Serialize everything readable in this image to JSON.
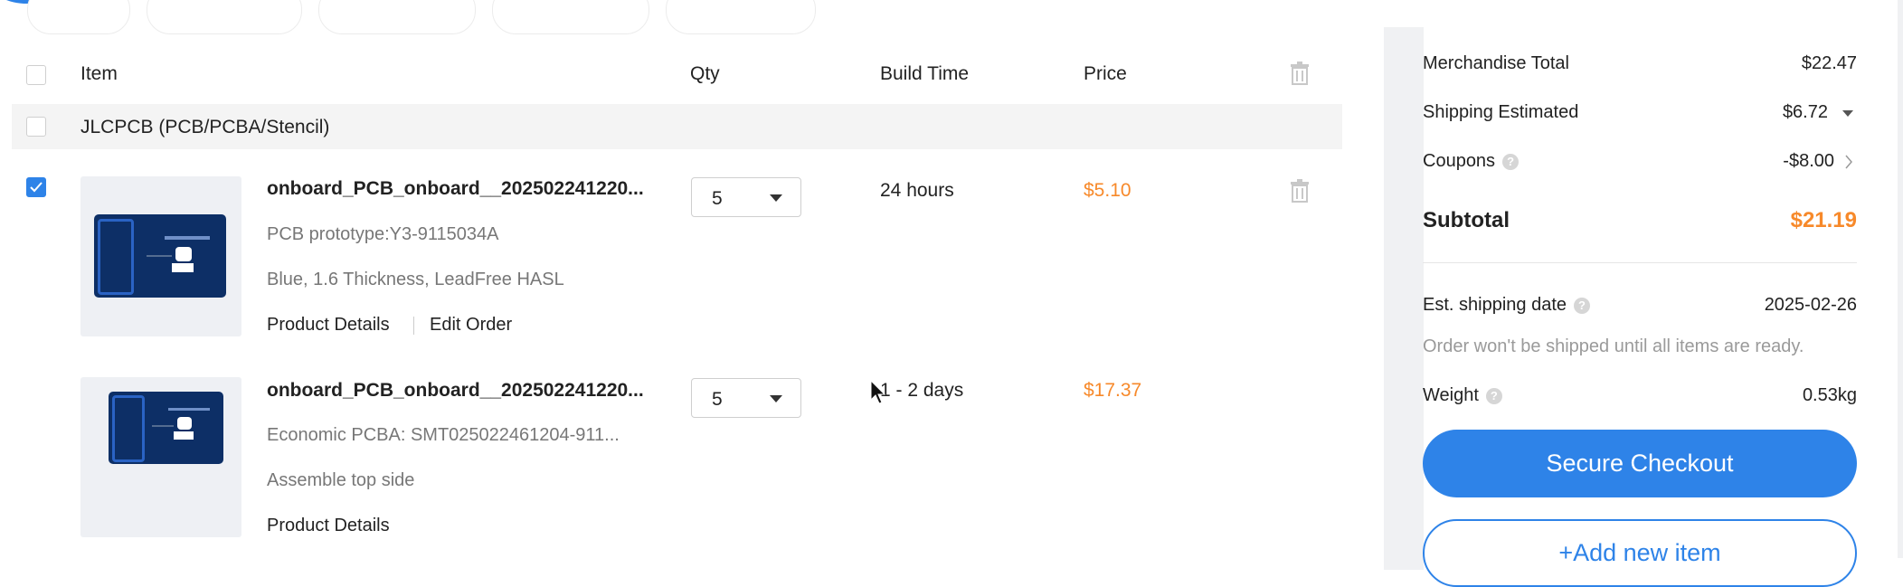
{
  "header": {
    "col_item": "Item",
    "col_qty": "Qty",
    "col_build_time": "Build Time",
    "col_price": "Price"
  },
  "group": {
    "label": "JLCPCB (PCB/PCBA/Stencil)"
  },
  "items": [
    {
      "title": "onboard_PCB_onboard__202502241220...",
      "line1": "PCB prototype:Y3-9115034A",
      "line2": "Blue, 1.6 Thickness, LeadFree HASL",
      "link1": "Product Details",
      "link2": "Edit Order",
      "qty": "5",
      "build_time": "24 hours",
      "price": "$5.10",
      "checked": true
    },
    {
      "title": "onboard_PCB_onboard__202502241220...",
      "line1": "Economic PCBA: SMT025022461204-911...",
      "line2": "Assemble top side",
      "link1": "Product Details",
      "qty": "5",
      "build_time": "1 - 2 days",
      "price": "$17.37",
      "checked": false
    }
  ],
  "summary": {
    "merch_label": "Merchandise Total",
    "merch_value": "$22.47",
    "ship_label": "Shipping Estimated",
    "ship_value": "$6.72",
    "coupons_label": "Coupons",
    "coupons_value": "-$8.00",
    "subtotal_label": "Subtotal",
    "subtotal_value": "$21.19",
    "est_ship_label": "Est. shipping date",
    "est_ship_value": "2025-02-26",
    "ship_note": "Order won't be shipped until all items are ready.",
    "weight_label": "Weight",
    "weight_value": "0.53kg",
    "checkout_label": "Secure Checkout",
    "add_new_label": "+Add new item"
  },
  "colors": {
    "accent": "#2e83e8",
    "price": "#f7892a"
  }
}
